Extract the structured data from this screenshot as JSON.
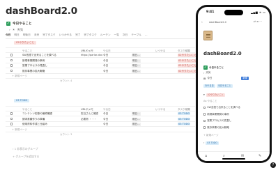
{
  "page": {
    "title": "dashBoard2.0"
  },
  "today_section": {
    "label": "今日やること",
    "check": "✓"
  },
  "weather": {
    "label": "天気",
    "icon": "sun-icon"
  },
  "tabs": [
    "今日",
    "明日",
    "明後日",
    "未来",
    "完了タスク",
    "いつかやる",
    "完了",
    "完了タスク",
    "ルーチン",
    "一覧",
    "次日",
    "テーブル",
    "…"
  ],
  "group_red": {
    "badge": "02やりたいこと",
    "headers": [
      "",
      "やること",
      "URLやメモ",
      "やる日",
      "",
      "いつやる",
      "タスク種類"
    ],
    "rows": [
      {
        "title": "SW言語で出来ることを調べる",
        "memo": "https://parlor-dxx",
        "day": "今日",
        "due": "明日...",
        "when": "",
        "type": "02やりたいこと"
      },
      {
        "title": "新規事業開発の事例",
        "memo": "",
        "day": "今日",
        "due": "明日...",
        "when": "",
        "type": "02やりたいこと"
      },
      {
        "title": "営業プロセスの見直し",
        "memo": "",
        "day": "今日",
        "due": "明日...",
        "when": "",
        "type": "02やりたいこと"
      },
      {
        "title": "既存事業の拡大戦略",
        "memo": "",
        "day": "今日",
        "due": "明日...",
        "when": "",
        "type": "02やりたいこと"
      }
    ],
    "new_page": "+ 新規ページ",
    "count": "カウント 4"
  },
  "group_blue": {
    "badge": "03 TODO",
    "headers": [
      "",
      "やること",
      "URLやメモ",
      "やる日",
      "",
      "いつやる",
      "タスク種類"
    ],
    "rows": [
      {
        "title": "コンテンツ形態の最終確認",
        "memo": "担当さんに確認",
        "day": "今日",
        "due": "明日...",
        "when": "",
        "type": "03 TODO"
      },
      {
        "title": "請求書類作りの準備",
        "memo": "必要物 ・・・",
        "day": "今日",
        "due": "明日...",
        "when": "",
        "type": "03 TODO"
      },
      {
        "title": "使用資料作成と仕組み",
        "memo": "",
        "day": "今日",
        "due": "明日...",
        "when": "",
        "type": "03 TODO"
      }
    ],
    "new_page": "+ 新規ページ",
    "count": "カウント 3"
  },
  "footer": {
    "hidden_groups": "› 1 非表示のグループ",
    "add_group": "+ グループを追加する"
  },
  "phone": {
    "time": "9:41",
    "status_icons": "▂▄▆ ≋ ▭",
    "breadcrumb": "dashBoard2.0",
    "back": "‹",
    "more_actions": "⇄ ≡ ⋯",
    "title": "dashBoard2.0",
    "section": "今日やること",
    "weather": "天気",
    "filter_label": "今日",
    "filter_pill": "新規",
    "subfilters": [
      "今やる日",
      "今日やること"
    ],
    "group_red_badge": "02やりたいこと",
    "list_header": "Aa やること",
    "items_red": [
      "SW言語で出来ることを調べる",
      "新規事業開発の事例",
      "営業プロセスの見直し",
      "既存事業の拡大戦略"
    ],
    "new_page": "+ 新規ページ",
    "group_blue_badge": "03 TODO",
    "tabbar": [
      "⌂",
      "⌕",
      "✉",
      "✎"
    ]
  },
  "corner": {
    "label": "?"
  },
  "colors": {
    "check": "#2e9d5c",
    "red_tag": "#fbe1df",
    "blue_tag": "#d9ecf9",
    "accent": "#3d7bd9"
  }
}
